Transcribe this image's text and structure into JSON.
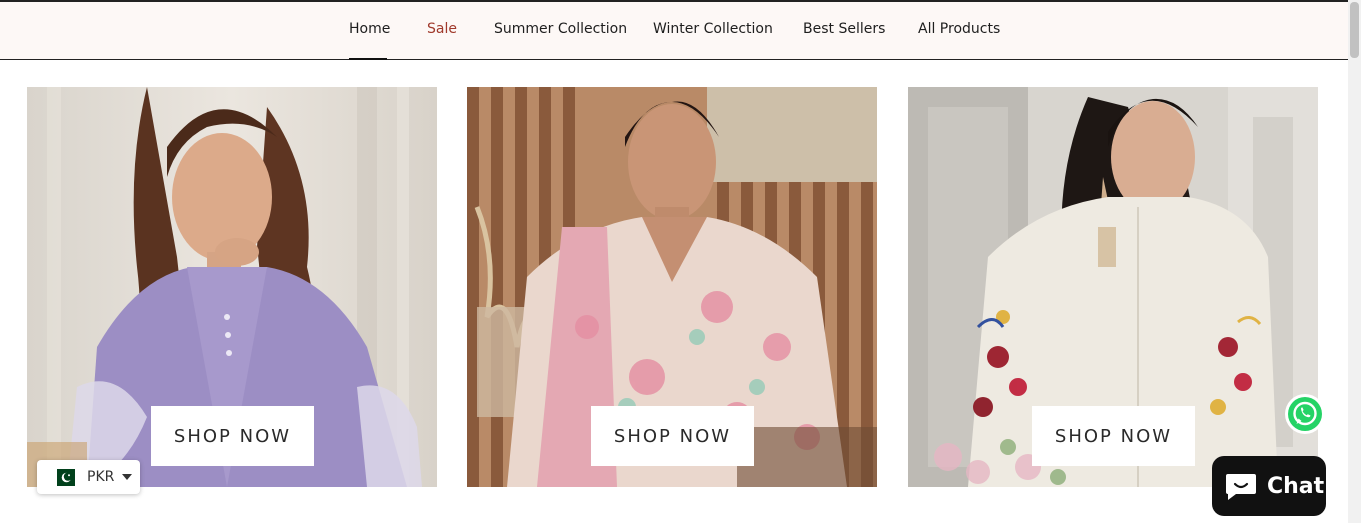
{
  "nav": {
    "items": [
      {
        "label": "Home",
        "active": true
      },
      {
        "label": "Sale",
        "highlight_color": "#a03a2c"
      },
      {
        "label": "Summer Collection"
      },
      {
        "label": "Winter Collection"
      },
      {
        "label": "Best Sellers"
      },
      {
        "label": "All Products"
      }
    ]
  },
  "collections": [
    {
      "button_label": "SHOP NOW",
      "image": "model-lavender-dress"
    },
    {
      "button_label": "SHOP NOW",
      "image": "model-pink-floral-dress"
    },
    {
      "button_label": "SHOP NOW",
      "image": "model-white-embroidered-dress"
    }
  ],
  "currency": {
    "code": "PKR",
    "flag": "pakistan-flag-icon"
  },
  "chat": {
    "label": "Chat",
    "icon": "chat-bubble-icon"
  },
  "whatsapp": {
    "icon": "whatsapp-icon"
  }
}
